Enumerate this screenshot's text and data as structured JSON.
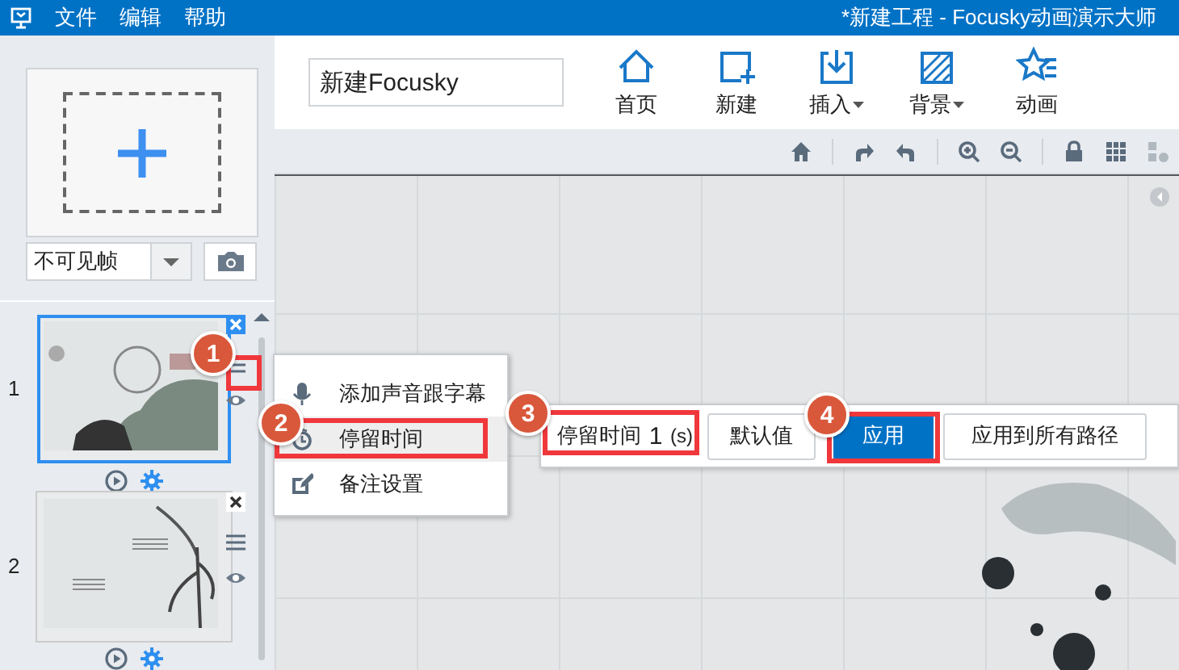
{
  "window": {
    "title": "*新建工程 - Focusky动画演示大师"
  },
  "menu": [
    "文件",
    "编辑",
    "帮助"
  ],
  "project_field": {
    "value": "新建Focusky"
  },
  "toolbar": [
    {
      "label": "首页",
      "dropdown": false
    },
    {
      "label": "新建",
      "dropdown": false
    },
    {
      "label": "插入",
      "dropdown": true
    },
    {
      "label": "背景",
      "dropdown": true
    },
    {
      "label": "动画",
      "dropdown": false
    }
  ],
  "frame_panel": {
    "frame_type": "不可见帧",
    "slides": [
      {
        "number": "1",
        "selected": true
      },
      {
        "number": "2",
        "selected": false
      }
    ]
  },
  "context_menu": {
    "items": [
      {
        "label": "添加声音跟字幕",
        "selected": false
      },
      {
        "label": "停留时间",
        "selected": true
      },
      {
        "label": "备注设置",
        "selected": false
      }
    ]
  },
  "stay_time_bar": {
    "label": "停留时间",
    "value": "1",
    "unit": "(s)",
    "buttons": [
      {
        "label": "默认值",
        "primary": false
      },
      {
        "label": "应用",
        "primary": true
      },
      {
        "label": "应用到所有路径",
        "primary": false
      }
    ]
  },
  "callouts": [
    "1",
    "2",
    "3",
    "4"
  ]
}
